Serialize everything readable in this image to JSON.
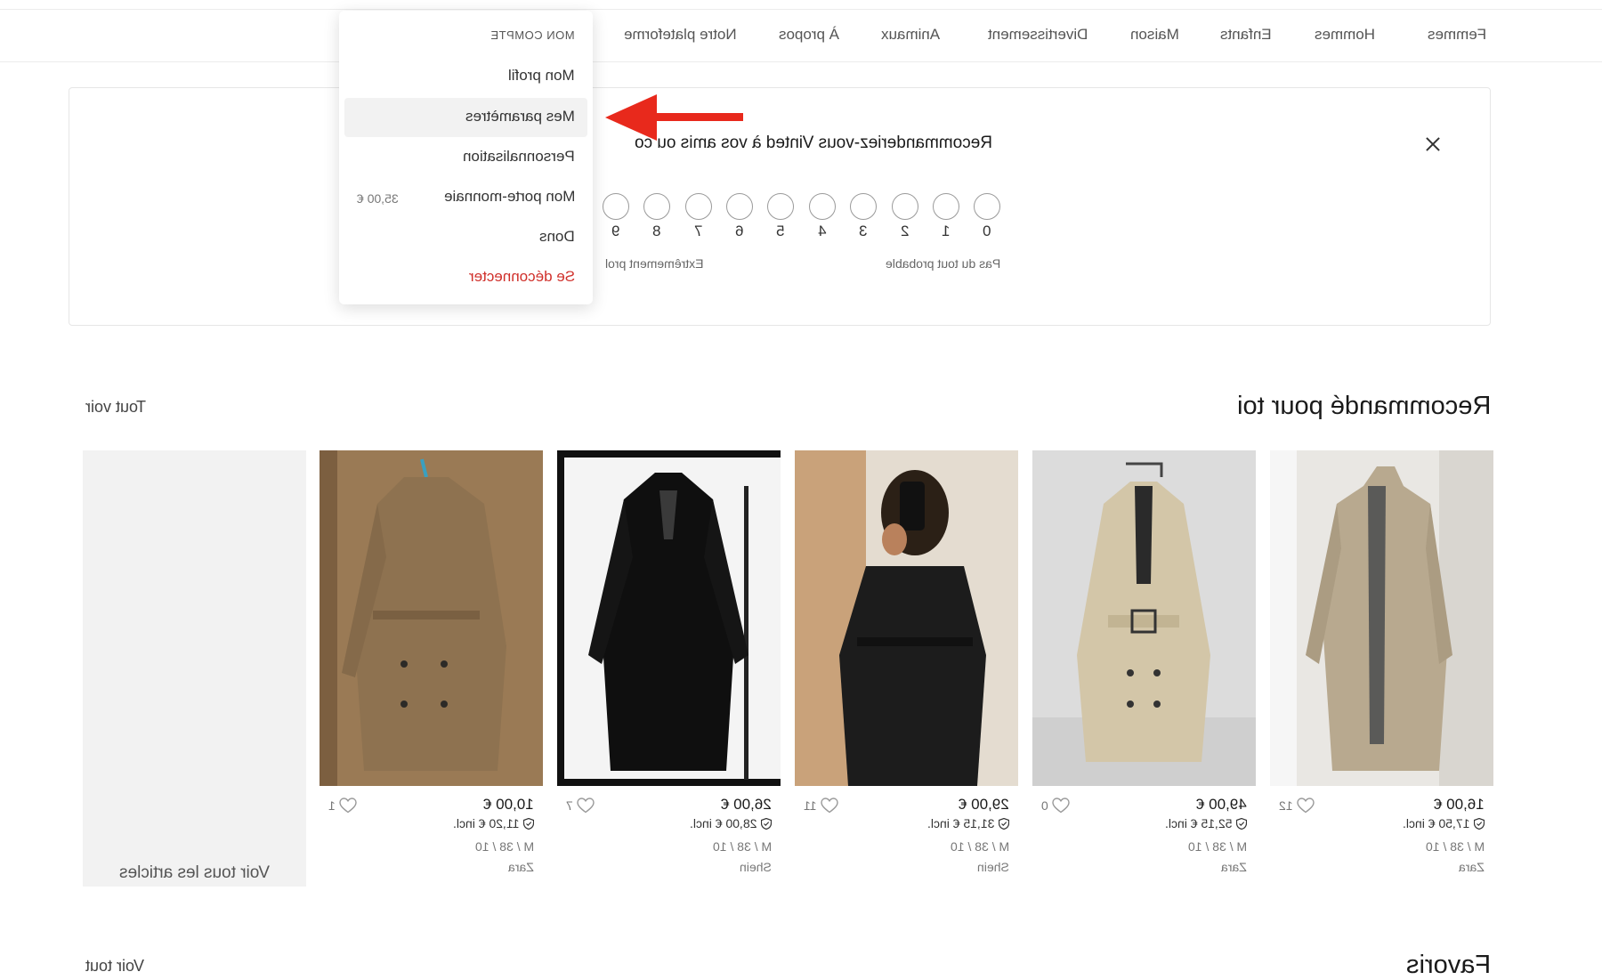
{
  "nav": {
    "items": [
      "Femmes",
      "Hommes",
      "Enfants",
      "Maison",
      "Divertissement",
      "Animaux",
      "À propos",
      "Notre plateforme"
    ]
  },
  "menu": {
    "header": "MON COMPTE",
    "items": [
      "Mon profil",
      "Mes paramètres",
      "Personnalisation",
      "Mon porte-monnaie",
      "Dons",
      "Se déconnecter"
    ],
    "wallet_balance": "35,00 €"
  },
  "survey": {
    "question": "Recommanderiez-vous Vinted à vos amis ou co",
    "scale": [
      "0",
      "1",
      "2",
      "3",
      "4",
      "5",
      "6",
      "7",
      "8",
      "9"
    ],
    "label_low": "Pas du tout probable",
    "label_high": "Extrêmement prol"
  },
  "recommended": {
    "title": "Recommandé pour toi",
    "see_all": "Tout voir",
    "see_all_tile": "Voir tous les articles",
    "items": [
      {
        "price": "16,00 €",
        "price_incl": "17,50 € incl.",
        "size": "M / 38 / 10",
        "brand": "Zara",
        "favorites": "12"
      },
      {
        "price": "49,00 €",
        "price_incl": "52,15 € incl.",
        "size": "M / 38 / 10",
        "brand": "Zara",
        "favorites": "0"
      },
      {
        "price": "29,00 €",
        "price_incl": "31,15 € incl.",
        "size": "M / 38 / 10",
        "brand": "Shein",
        "favorites": "11"
      },
      {
        "price": "26,00 €",
        "price_incl": "28,00 € incl.",
        "size": "M / 38 / 10",
        "brand": "Shein",
        "favorites": "7"
      },
      {
        "price": "10,00 €",
        "price_incl": "11,20 € incl.",
        "size": "M / 38 / 10",
        "brand": "Zara",
        "favorites": "1"
      }
    ]
  },
  "favorites": {
    "title": "Favoris",
    "see_all": "Voir tout"
  },
  "colors": {
    "logout": "#d0302b",
    "arrow": "#e8291c",
    "highlight": "#f2f2f2"
  }
}
